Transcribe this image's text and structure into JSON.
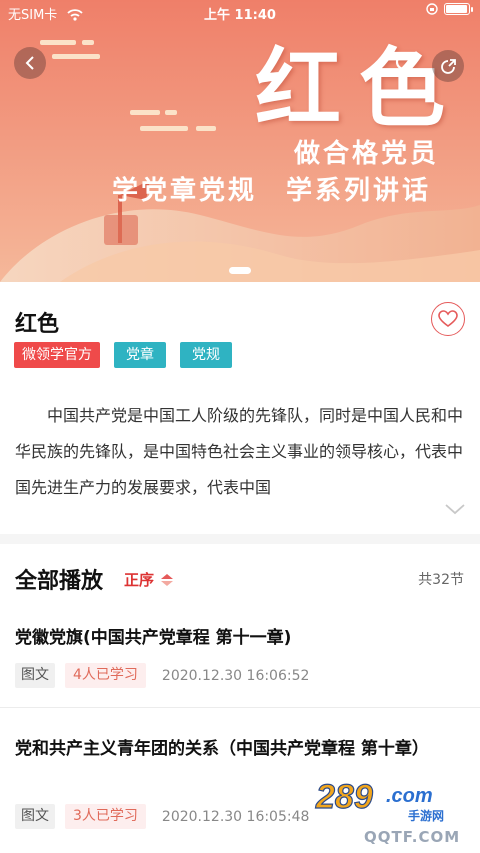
{
  "status_bar": {
    "carrier": "无SIM卡",
    "time": "上午 11:40"
  },
  "banner": {
    "title": "红色",
    "line1": "做合格党员",
    "line2": "学党章党规　学系列讲话",
    "colors": {
      "top": "#f08a6e",
      "bottom": "#f4c4a0"
    }
  },
  "course": {
    "title": "红色",
    "tags": [
      "微领学官方",
      "党章",
      "党规"
    ],
    "description": "中国共产党是中国工人阶级的先锋队，同时是中国人民和中华民族的先锋队，是中国特色社会主义事业的领导核心，代表中国先进生产力的发展要求，代表中国"
  },
  "playlist": {
    "title": "全部播放",
    "sort_label": "正序",
    "count_label": "共32节",
    "items": [
      {
        "title": "党徽党旗(中国共产党章程 第十一章)",
        "type": "图文",
        "learners": "4人已学习",
        "date": "2020.12.30 16:06:52"
      },
      {
        "title": "党和共产主义青年团的关系（中国共产党章程 第十章）",
        "type": "图文",
        "learners": "3人已学习",
        "date": "2020.12.30 16:05:48"
      }
    ]
  },
  "watermark": {
    "logo": "289.com",
    "brand": "手游网",
    "url": "QQTF.COM"
  }
}
